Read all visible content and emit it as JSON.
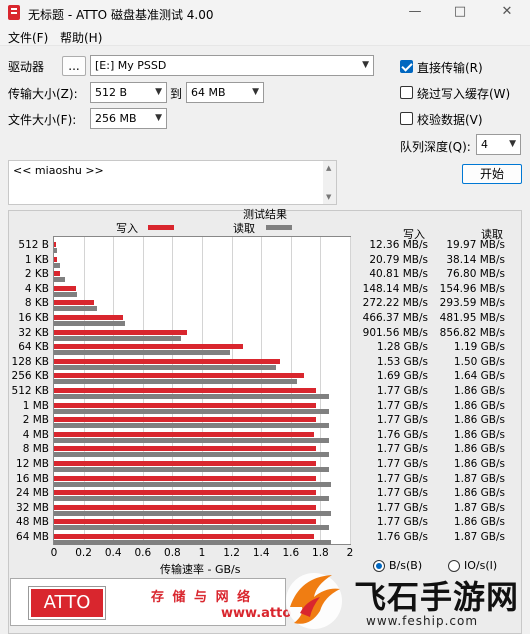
{
  "window": {
    "title": "无标题 - ATTO 磁盘基准测试 4.00"
  },
  "menu": {
    "file": "文件(F)",
    "help": "帮助(H)"
  },
  "controls": {
    "drive_label": "驱动器",
    "browse_label": "...",
    "drive_value": "[E:] My PSSD",
    "transfer_label": "传输大小(Z):",
    "transfer_from": "512 B",
    "to_label": "到",
    "transfer_to": "64 MB",
    "file_label": "文件大小(F):",
    "file_value": "256 MB",
    "direct_io": "直接传输(R)",
    "bypass_cache": "绕过写入缓存(W)",
    "verify": "校验数据(V)",
    "queue_label": "队列深度(Q):",
    "queue_value": "4",
    "start": "开始"
  },
  "description": "<< miaoshu >>",
  "results": {
    "title": "测试结果",
    "legend_write": "写入",
    "legend_read": "读取",
    "col_write": "写入",
    "col_read": "读取",
    "x_axis_label": "传输速率 - GB/s",
    "units_bytes": "B/s(B)",
    "units_io": "IO/s(I)"
  },
  "chart_data": {
    "type": "bar",
    "orientation": "horizontal",
    "title": "测试结果",
    "xlabel": "传输速率 - GB/s",
    "xlim": [
      0,
      2
    ],
    "xticks": [
      "0",
      "0.2",
      "0.4",
      "0.6",
      "0.8",
      "1",
      "1.2",
      "1.4",
      "1.6",
      "1.8",
      "2"
    ],
    "categories": [
      "512 B",
      "1 KB",
      "2 KB",
      "4 KB",
      "8 KB",
      "16 KB",
      "32 KB",
      "64 KB",
      "128 KB",
      "256 KB",
      "512 KB",
      "1 MB",
      "2 MB",
      "4 MB",
      "8 MB",
      "12 MB",
      "16 MB",
      "24 MB",
      "32 MB",
      "48 MB",
      "64 MB"
    ],
    "series": [
      {
        "name": "写入",
        "color": "#d9262e",
        "values": [
          0.01236,
          0.02079,
          0.04081,
          0.14814,
          0.27222,
          0.46637,
          0.90156,
          1.28,
          1.53,
          1.69,
          1.77,
          1.77,
          1.77,
          1.76,
          1.77,
          1.77,
          1.77,
          1.77,
          1.77,
          1.77,
          1.76
        ],
        "labels": [
          "12.36 MB/s",
          "20.79 MB/s",
          "40.81 MB/s",
          "148.14 MB/s",
          "272.22 MB/s",
          "466.37 MB/s",
          "901.56 MB/s",
          "1.28 GB/s",
          "1.53 GB/s",
          "1.69 GB/s",
          "1.77 GB/s",
          "1.77 GB/s",
          "1.77 GB/s",
          "1.76 GB/s",
          "1.77 GB/s",
          "1.77 GB/s",
          "1.77 GB/s",
          "1.77 GB/s",
          "1.77 GB/s",
          "1.77 GB/s",
          "1.76 GB/s"
        ]
      },
      {
        "name": "读取",
        "color": "#808080",
        "values": [
          0.01997,
          0.03814,
          0.0768,
          0.15496,
          0.29359,
          0.48195,
          0.85682,
          1.19,
          1.5,
          1.64,
          1.86,
          1.86,
          1.86,
          1.86,
          1.86,
          1.86,
          1.87,
          1.86,
          1.87,
          1.86,
          1.87
        ],
        "labels": [
          "19.97 MB/s",
          "38.14 MB/s",
          "76.80 MB/s",
          "154.96 MB/s",
          "293.59 MB/s",
          "481.95 MB/s",
          "856.82 MB/s",
          "1.19 GB/s",
          "1.50 GB/s",
          "1.64 GB/s",
          "1.86 GB/s",
          "1.86 GB/s",
          "1.86 GB/s",
          "1.86 GB/s",
          "1.86 GB/s",
          "1.86 GB/s",
          "1.87 GB/s",
          "1.86 GB/s",
          "1.87 GB/s",
          "1.86 GB/s",
          "1.87 GB/s"
        ]
      }
    ],
    "grid": true
  },
  "banner": {
    "logo": "ATTO",
    "tagline": "存 储 与 网 络",
    "url": "www.atto"
  },
  "watermark": {
    "text": "飞石手游网",
    "url": "www.feship.com"
  }
}
